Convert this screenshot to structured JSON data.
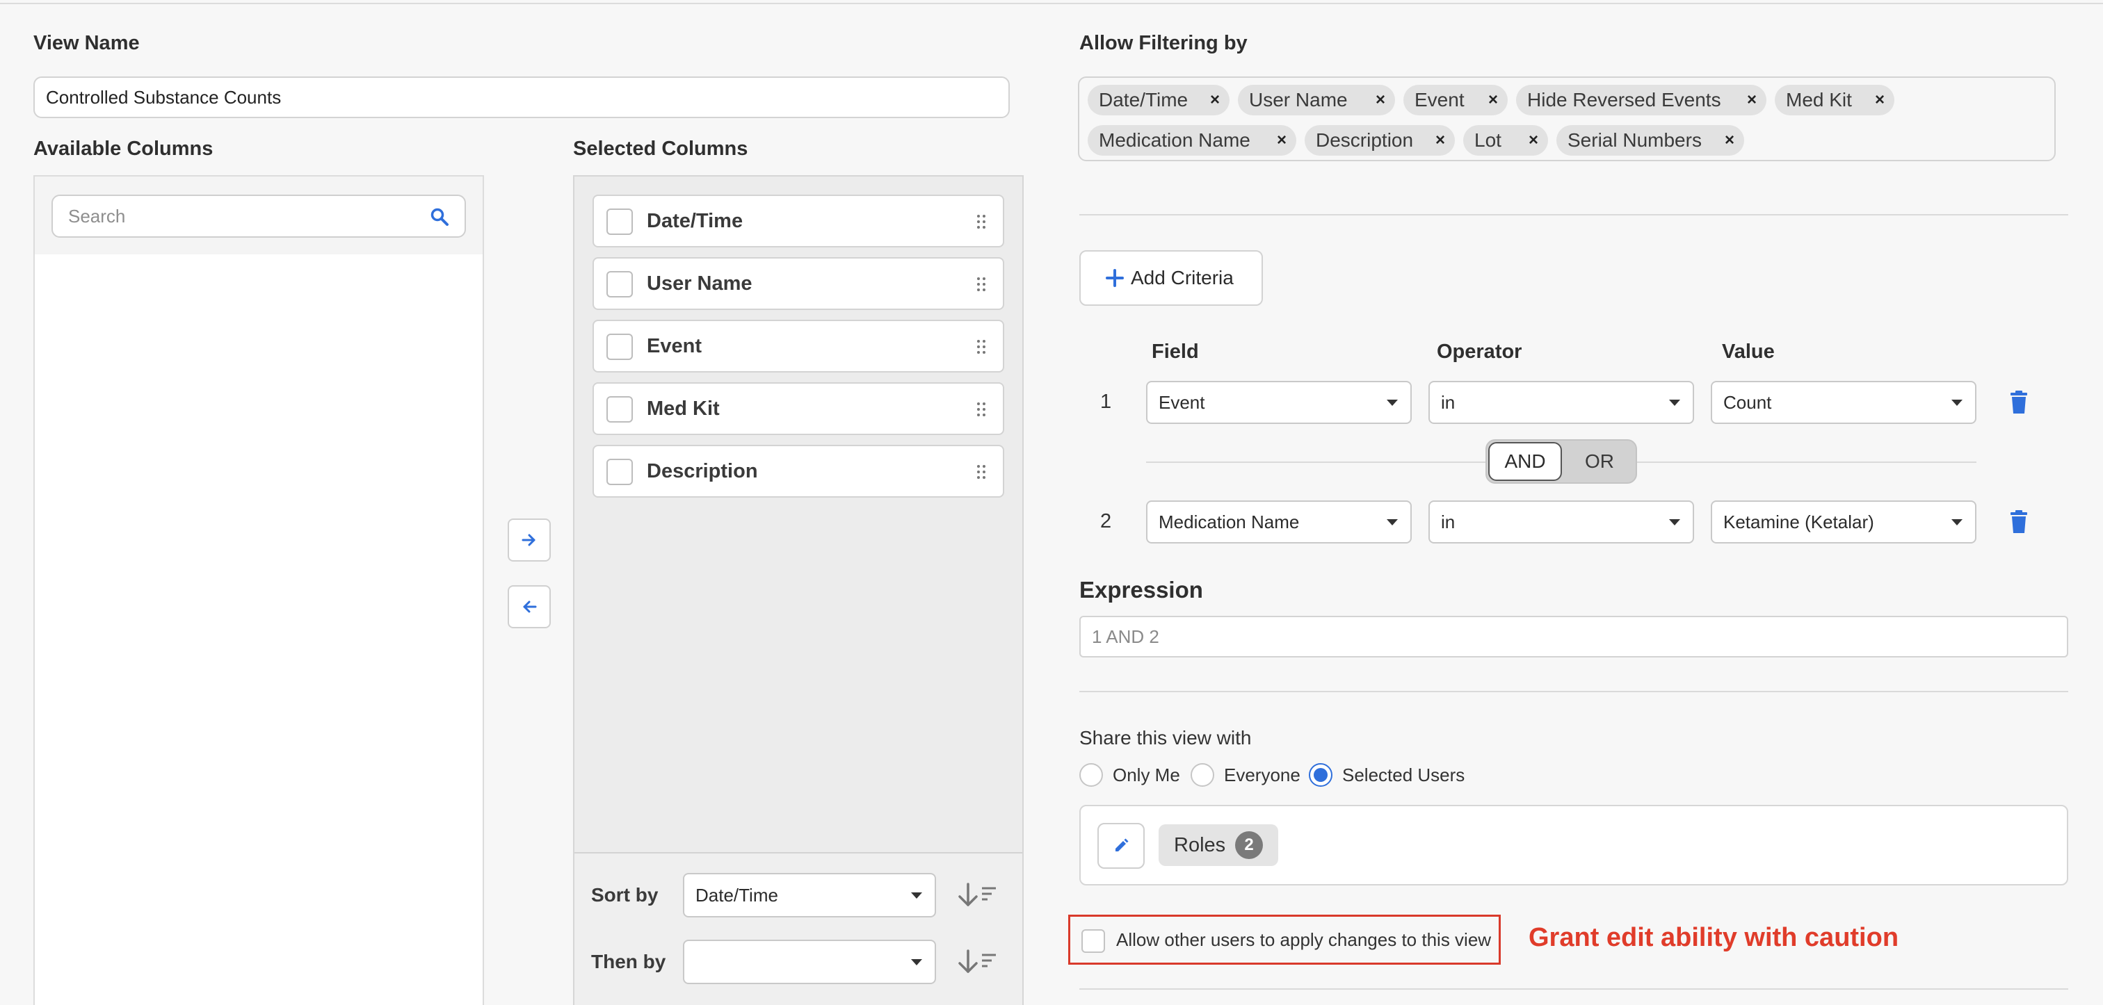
{
  "view_name": {
    "label": "View Name",
    "value": "Controlled Substance Counts"
  },
  "available_columns": {
    "title": "Available Columns",
    "search_placeholder": "Search",
    "items": []
  },
  "selected_columns": {
    "title": "Selected Columns",
    "items": [
      {
        "label": "Date/Time"
      },
      {
        "label": "User Name"
      },
      {
        "label": "Event"
      },
      {
        "label": "Med Kit"
      },
      {
        "label": "Description"
      }
    ]
  },
  "sorting": {
    "sort_by_label": "Sort by",
    "sort_by_value": "Date/Time",
    "then_by_label": "Then by",
    "then_by_value": ""
  },
  "filtering": {
    "title": "Allow Filtering by",
    "chips": [
      "Date/Time",
      "User Name",
      "Event",
      "Hide Reversed Events",
      "Med Kit",
      "Medication Name",
      "Description",
      "Lot",
      "Serial Numbers"
    ],
    "remove_glyph": "×"
  },
  "criteria": {
    "add_label": "Add Criteria",
    "headers": {
      "field": "Field",
      "operator": "Operator",
      "value": "Value"
    },
    "rows": [
      {
        "num": "1",
        "field": "Event",
        "operator": "in",
        "value": "Count"
      },
      {
        "num": "2",
        "field": "Medication Name",
        "operator": "in",
        "value": "Ketamine (Ketalar)"
      }
    ],
    "and_label": "AND",
    "or_label": "OR",
    "selected_conjunction": "AND"
  },
  "expression": {
    "label": "Expression",
    "value": "1 AND 2"
  },
  "share": {
    "label": "Share this view with",
    "options": [
      "Only Me",
      "Everyone",
      "Selected Users"
    ],
    "selected": "Selected Users",
    "roles_label": "Roles",
    "roles_count": "2"
  },
  "allow_edit": {
    "label": "Allow other users to apply changes to this view",
    "checked": false,
    "warning": "Grant edit ability with caution"
  },
  "colors": {
    "accent": "#2f6fdb",
    "warning": "#e03c2a"
  },
  "icons": [
    "search-icon",
    "arrow-right-icon",
    "arrow-left-icon",
    "drag-handle-icon",
    "sort-icon",
    "plus-icon",
    "trash-icon",
    "pencil-icon",
    "caret-down-icon"
  ]
}
